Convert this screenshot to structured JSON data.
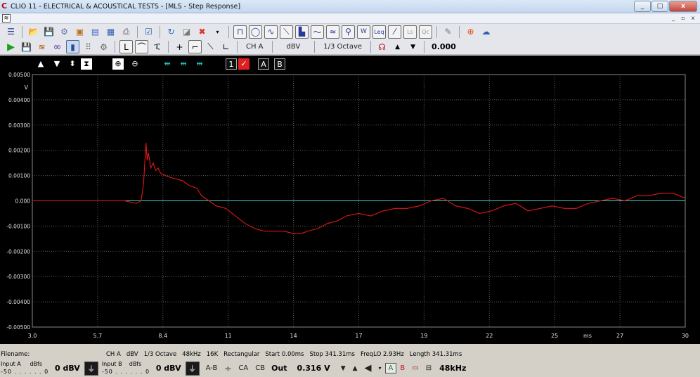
{
  "window": {
    "title": "CLIO 11 - ELECTRICAL & ACOUSTICAL TESTS - [MLS - Step Response]",
    "app_icon": "C",
    "controls": [
      "_",
      "□",
      "x"
    ]
  },
  "mdi": {
    "controls": [
      "_",
      "▫",
      "x"
    ]
  },
  "toolbar2": {
    "channel": "CH A",
    "unit": "dBV",
    "smoothing": "1/3 Octave",
    "value": "0.000"
  },
  "plot": {
    "tool_labels": {
      "swap1": "1",
      "check": "✓",
      "a": "A",
      "b": "B"
    },
    "y_axis": {
      "unit": "V",
      "min": -0.005,
      "max": 0.005,
      "ticks": [
        "0.00500",
        "0.00400",
        "0.00300",
        "0.00200",
        "0.00100",
        "0.000",
        "-0.00100",
        "-0.00200",
        "-0.00300",
        "-0.00400",
        "-0.00500"
      ]
    },
    "x_axis": {
      "unit": "ms",
      "min": 3.0,
      "max": 30,
      "ticks": [
        "3.0",
        "5.7",
        "8.4",
        "11",
        "14",
        "17",
        "19",
        "22",
        "25",
        "27",
        "30"
      ]
    },
    "colors": {
      "trace": "#e01818",
      "zero_line": "#3cc8c8",
      "grid": "#5a5a5a",
      "background": "#000000"
    }
  },
  "chart_data": {
    "type": "line",
    "title": "",
    "xlabel": "ms",
    "ylabel": "V",
    "xlim": [
      3.0,
      30
    ],
    "ylim": [
      -0.005,
      0.005
    ],
    "grid": true,
    "series": [
      {
        "x": [
          3.0,
          4.0,
          5.0,
          6.0,
          6.8,
          7.3,
          7.5,
          7.6,
          7.7,
          7.75,
          7.8,
          7.9,
          8.0,
          8.1,
          8.2,
          8.3,
          8.5,
          8.8,
          9.2,
          9.5,
          9.8,
          10.0,
          10.3,
          10.6,
          11.0,
          11.4,
          11.8,
          12.2,
          12.6,
          13.0,
          13.4,
          13.8,
          14.1,
          14.4,
          14.8,
          15.2,
          15.6,
          16.0,
          16.5,
          17.0,
          17.5,
          18.0,
          18.5,
          19.0,
          19.5,
          20.0,
          20.5,
          21.0,
          21.5,
          22.0,
          22.5,
          23.0,
          23.5,
          24.0,
          24.5,
          25.0,
          25.5,
          26.0,
          26.5,
          27.0,
          27.5,
          28.0,
          28.5,
          29.0,
          29.5,
          30.0
        ],
        "y": [
          0.0,
          0.0,
          0.0,
          0.0,
          0.0,
          -0.0001,
          0.0,
          0.0007,
          0.0023,
          0.0016,
          0.0019,
          0.0013,
          0.0015,
          0.0012,
          0.0013,
          0.0011,
          0.001,
          0.0009,
          0.0008,
          0.0006,
          0.0005,
          0.0002,
          0.0,
          -0.0002,
          -0.0003,
          -0.0006,
          -0.0009,
          -0.0011,
          -0.0012,
          -0.0012,
          -0.0012,
          -0.0013,
          -0.0013,
          -0.0012,
          -0.0011,
          -0.0009,
          -0.0008,
          -0.0006,
          -0.0005,
          -0.0006,
          -0.0004,
          -0.0003,
          -0.0003,
          -0.0002,
          0.0,
          0.0001,
          -0.0002,
          -0.0003,
          -0.0005,
          -0.0004,
          -0.0002,
          -0.0001,
          -0.0004,
          -0.0003,
          -0.0002,
          -0.0003,
          -0.0003,
          -0.0001,
          0.0,
          0.0001,
          0.0,
          0.0002,
          0.0002,
          0.0003,
          0.0003,
          0.0001
        ]
      }
    ]
  },
  "status": {
    "filename_label": "Filename:",
    "info": [
      "CH A",
      "dBV",
      "1/3 Octave",
      "48kHz",
      "16K",
      "Rectangular",
      "Start 0.00ms",
      "Stop 341.31ms",
      "FreqLO 2.93Hz",
      "Length 341.31ms"
    ]
  },
  "bottom": {
    "input_a_label": "Input A",
    "input_a_unit": "dBfs",
    "input_a_scale_left": "-50",
    "input_a_scale_right": "0",
    "input_a_value": "0 dBV",
    "input_b_label": "Input B",
    "input_b_unit": "dBfs",
    "input_b_scale_left": "-50",
    "input_b_scale_right": "0",
    "input_b_value": "0 dBV",
    "ab_label": "A-B",
    "ca_label": "CA",
    "cb_label": "CB",
    "out_label": "Out",
    "out_value": "0.316 V",
    "a_label": "A",
    "b_label": "B",
    "sample_rate": "48kHz"
  }
}
